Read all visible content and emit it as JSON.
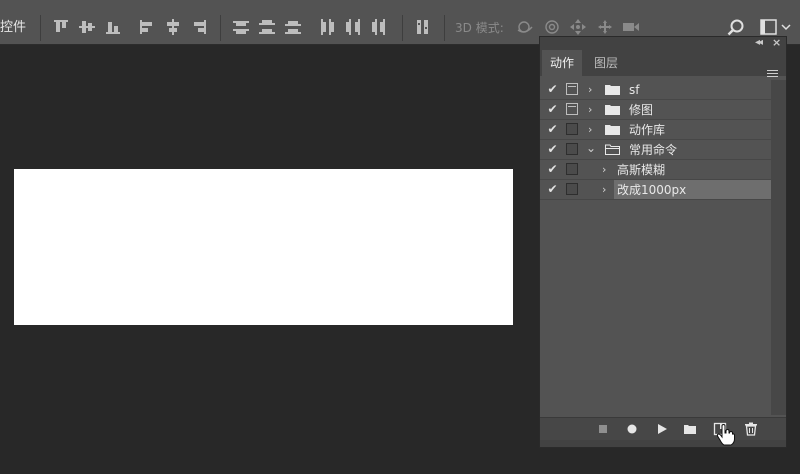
{
  "options_bar": {
    "label": "控件",
    "three_d_mode_label": "3D 模式:"
  },
  "panel": {
    "tabs": [
      {
        "label": "动作",
        "active": true
      },
      {
        "label": "图层",
        "active": false
      }
    ],
    "actions": [
      {
        "label": "sf",
        "type": "set",
        "checked": true,
        "dialog_toggle": true,
        "expanded": false
      },
      {
        "label": "修图",
        "type": "set",
        "checked": true,
        "dialog_toggle": true,
        "expanded": false
      },
      {
        "label": "动作库",
        "type": "set",
        "checked": true,
        "dialog_toggle": false,
        "expanded": false
      },
      {
        "label": "常用命令",
        "type": "set",
        "checked": true,
        "dialog_toggle": false,
        "expanded": true
      },
      {
        "label": "高斯模糊",
        "type": "action",
        "checked": true,
        "dialog_toggle": false,
        "expanded": false
      },
      {
        "label": "改成1000px",
        "type": "action",
        "checked": true,
        "dialog_toggle": false,
        "expanded": false,
        "selected": true
      }
    ],
    "bottom_icons": [
      "stop-icon",
      "record-icon",
      "play-icon",
      "new-set-icon",
      "new-action-icon",
      "trash-icon"
    ]
  },
  "colors": {
    "app_background": "#282828",
    "toolbar": "#535353",
    "panel": "#535353",
    "selected_row": "#6e6e6e",
    "canvas": "#ffffff"
  }
}
